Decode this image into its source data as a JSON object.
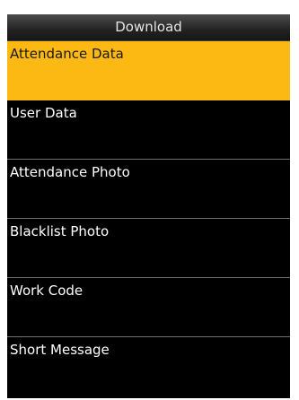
{
  "header": {
    "title": "Download"
  },
  "menu": {
    "items": [
      {
        "label": "Attendance Data",
        "selected": true
      },
      {
        "label": "User Data",
        "selected": false
      },
      {
        "label": "Attendance Photo",
        "selected": false
      },
      {
        "label": "Blacklist Photo",
        "selected": false
      },
      {
        "label": "Work Code",
        "selected": false
      },
      {
        "label": "Short Message",
        "selected": false
      }
    ]
  },
  "colors": {
    "screen_background": "#000000",
    "selected_background": "#fcb813",
    "divider": "#6e6e6e"
  }
}
